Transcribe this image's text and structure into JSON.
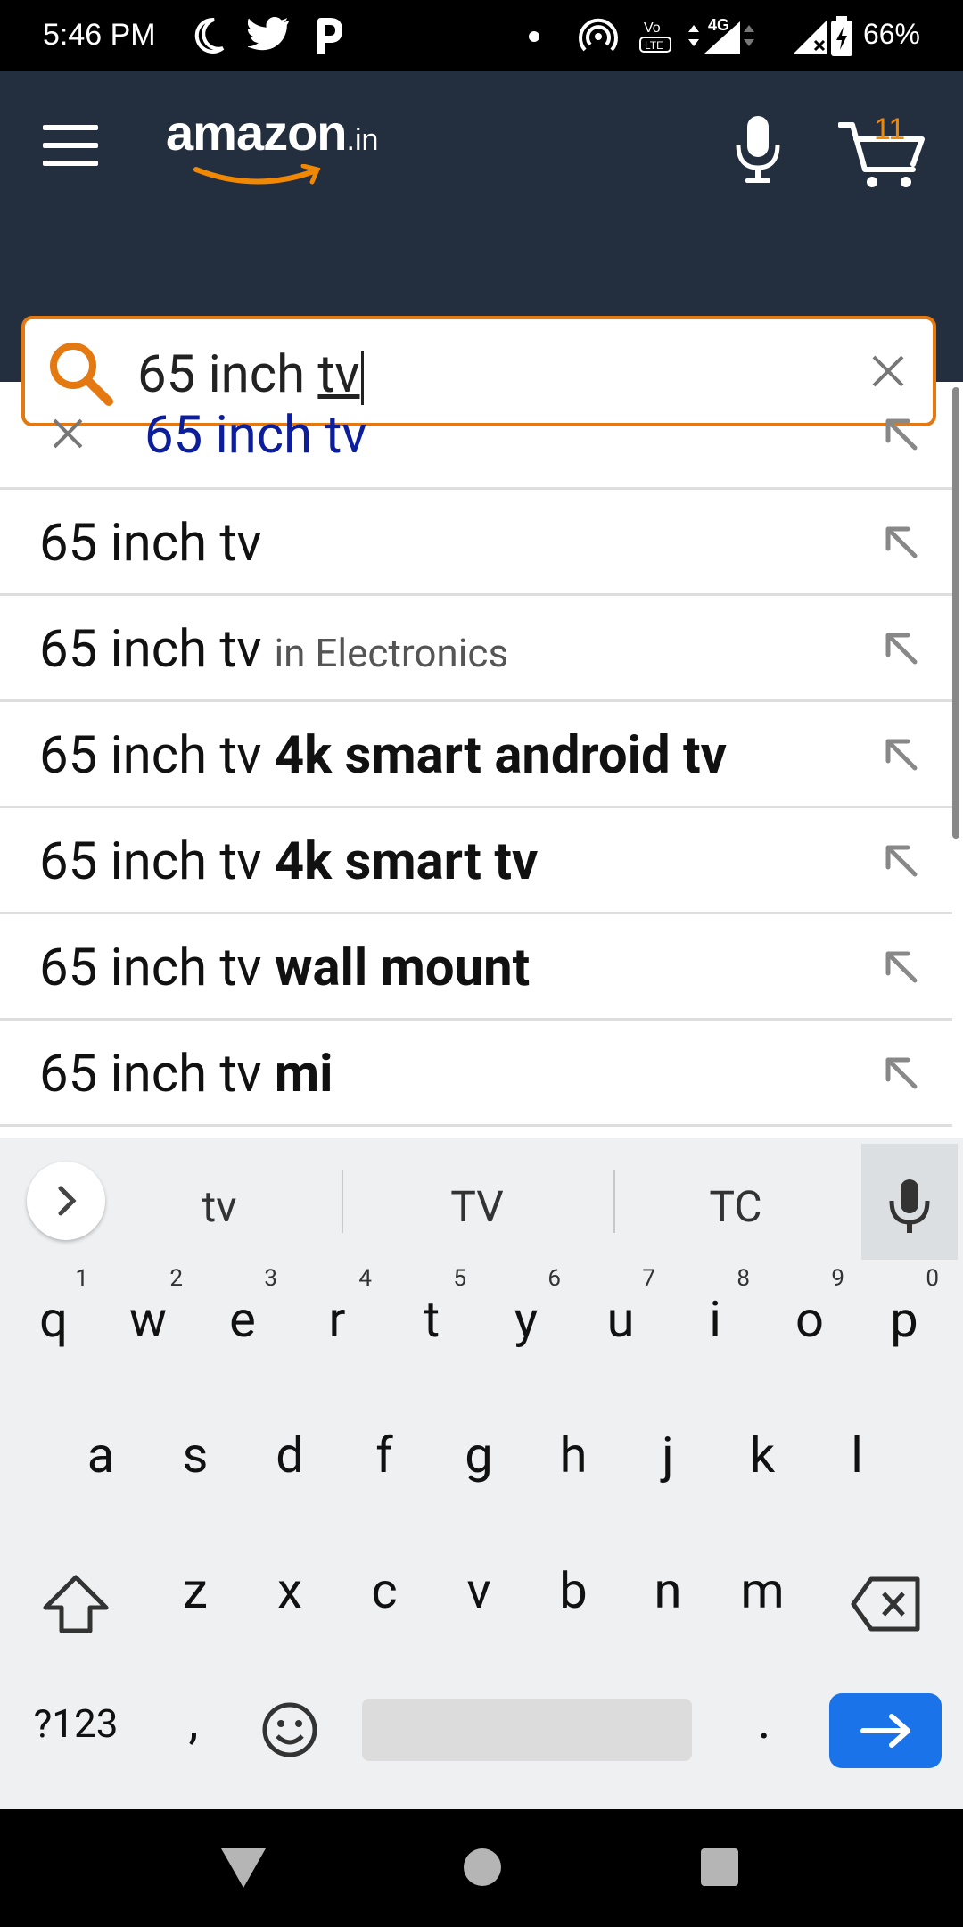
{
  "status_bar": {
    "time": "5:46 PM",
    "battery": "66%",
    "icons": [
      "moon-icon",
      "twitter-icon",
      "p-app-icon",
      "dot-icon",
      "hotspot-icon",
      "volte-icon",
      "4g-signal-icon",
      "signal-icon",
      "battery-icon"
    ],
    "network": "4G"
  },
  "header": {
    "logo_text": "amazon",
    "logo_suffix": ".in",
    "cart_count": "11"
  },
  "search": {
    "value_prefix": "65 inch ",
    "value_underlined": "tv"
  },
  "suggestions": {
    "history": "65 inch tv",
    "items": [
      {
        "prefix": "65 inch tv",
        "bold": ""
      },
      {
        "prefix": "65 inch tv",
        "dept": "in Electronics"
      },
      {
        "prefix": "65 inch tv ",
        "bold": "4k smart android tv"
      },
      {
        "prefix": "65 inch tv ",
        "bold": "4k smart tv"
      },
      {
        "prefix": "65 inch tv ",
        "bold": "wall mount"
      },
      {
        "prefix": "65 inch tv ",
        "bold": "mi"
      }
    ]
  },
  "keyboard": {
    "word_suggestions": [
      "tv",
      "TV",
      "TC"
    ],
    "row1": [
      {
        "key": "q",
        "num": "1"
      },
      {
        "key": "w",
        "num": "2"
      },
      {
        "key": "e",
        "num": "3"
      },
      {
        "key": "r",
        "num": "4"
      },
      {
        "key": "t",
        "num": "5"
      },
      {
        "key": "y",
        "num": "6"
      },
      {
        "key": "u",
        "num": "7"
      },
      {
        "key": "i",
        "num": "8"
      },
      {
        "key": "o",
        "num": "9"
      },
      {
        "key": "p",
        "num": "0"
      }
    ],
    "row2": [
      "a",
      "s",
      "d",
      "f",
      "g",
      "h",
      "j",
      "k",
      "l"
    ],
    "row3": [
      "z",
      "x",
      "c",
      "v",
      "b",
      "n",
      "m"
    ],
    "symbols_label": "?123",
    "comma": ",",
    "period": "."
  },
  "colors": {
    "header_bg": "#232f3e",
    "accent_orange": "#e47911",
    "history_blue": "#0d1e9c",
    "enter_blue": "#1a73e8"
  }
}
